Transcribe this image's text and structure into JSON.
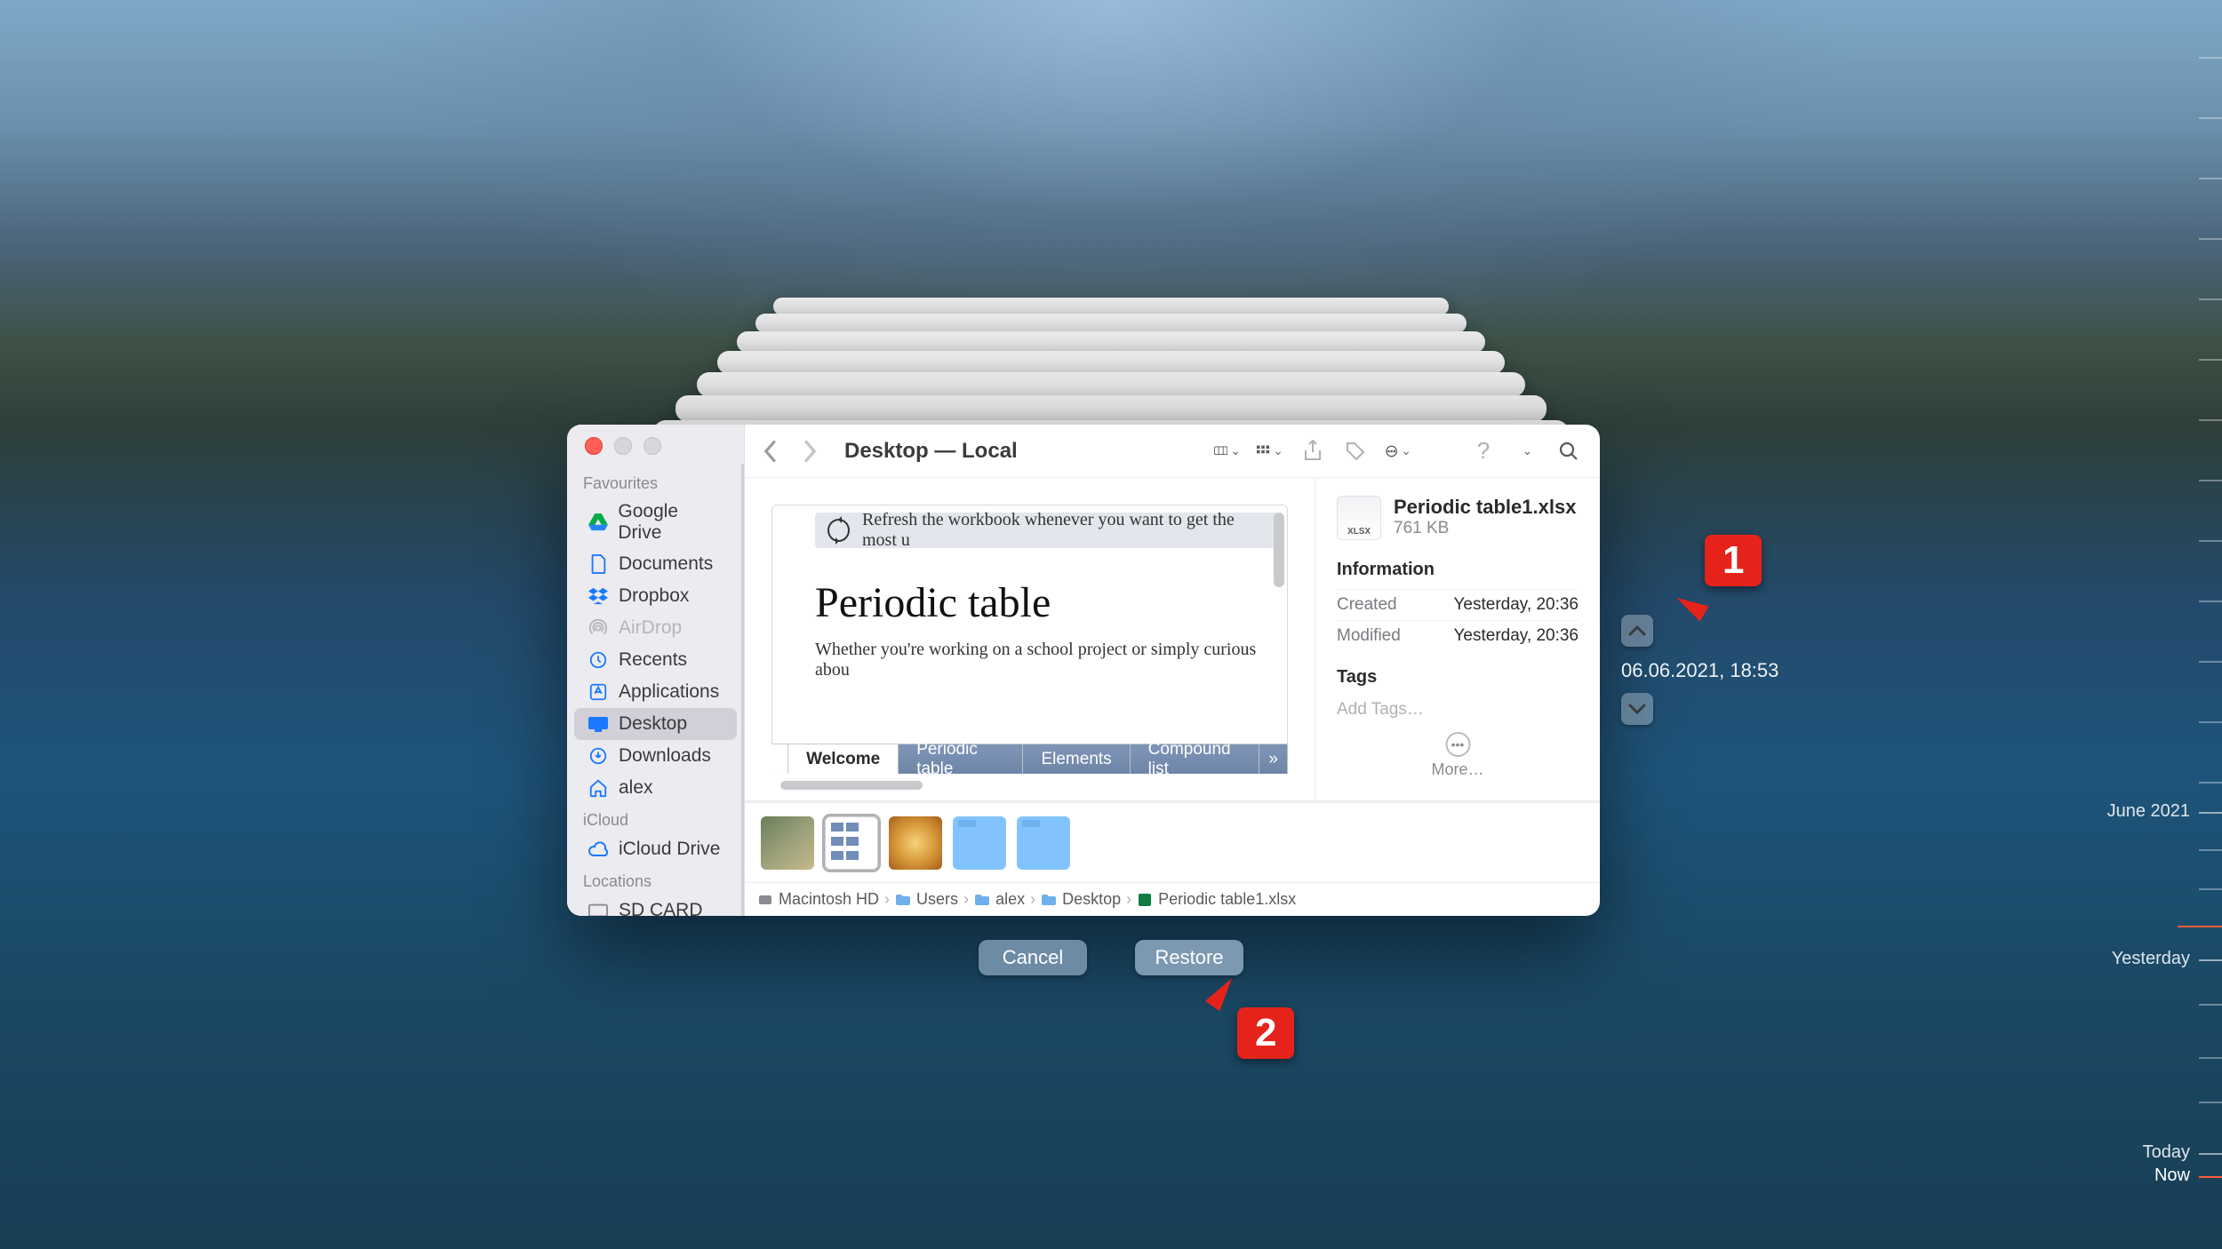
{
  "window": {
    "title": "Desktop — Local"
  },
  "toolbar": {
    "chevron": "⌄"
  },
  "sidebar": {
    "favourites_label": "Favourites",
    "icloud_label": "iCloud",
    "locations_label": "Locations",
    "items": {
      "gdrive": "Google Drive",
      "documents": "Documents",
      "dropbox": "Dropbox",
      "airdrop": "AirDrop",
      "recents": "Recents",
      "applications": "Applications",
      "desktop": "Desktop",
      "downloads": "Downloads",
      "home": "alex",
      "iclouddrive": "iCloud Drive",
      "sdcard": "SD CARD"
    }
  },
  "preview": {
    "banner": "Refresh the workbook whenever you want to get the most u",
    "title": "Periodic table",
    "subtitle": "Whether you're working on a school project or simply curious abou",
    "tabs": {
      "welcome": "Welcome",
      "ptable": "Periodic table",
      "elements": "Elements",
      "compounds": "Compound list",
      "more": "»"
    }
  },
  "info": {
    "filename": "Periodic table1.xlsx",
    "filesize": "761 KB",
    "xlsx_badge": "XLSX",
    "info_header": "Information",
    "created_k": "Created",
    "created_v": "Yesterday, 20:36",
    "modified_k": "Modified",
    "modified_v": "Yesterday, 20:36",
    "tags_header": "Tags",
    "add_tags": "Add Tags…",
    "more": "More…"
  },
  "pathbar": {
    "seg0": "Macintosh HD",
    "seg1": "Users",
    "seg2": "alex",
    "seg3": "Desktop",
    "seg4": "Periodic table1.xlsx",
    "sep": "›"
  },
  "actions": {
    "cancel": "Cancel",
    "restore": "Restore"
  },
  "timemachine": {
    "timestamp": "06.06.2021, 18:53"
  },
  "ruler": {
    "month": "June 2021",
    "yesterday": "Yesterday",
    "today": "Today",
    "now": "Now"
  },
  "callouts": {
    "one": "1",
    "two": "2"
  }
}
